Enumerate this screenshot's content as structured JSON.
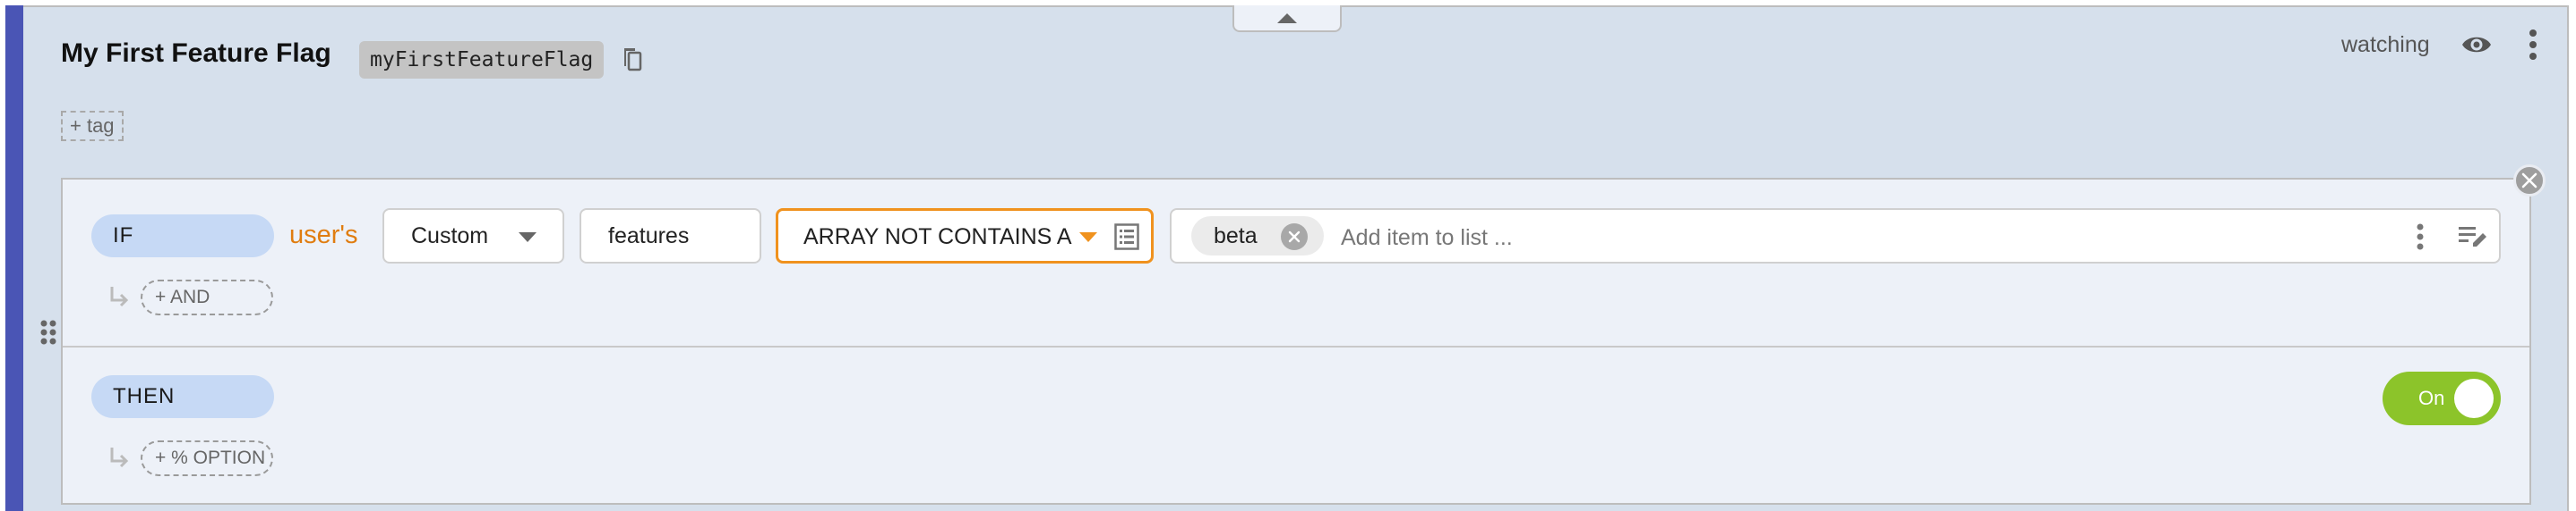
{
  "flag": {
    "title": "My First Feature Flag",
    "key": "myFirstFeatureFlag",
    "add_tag_label": "+ tag",
    "watch_status": "watching"
  },
  "rule": {
    "if_label": "IF",
    "subject_label": "user's",
    "attribute_type": "Custom",
    "attribute_name": "features",
    "operator": "ARRAY NOT CONTAINS A",
    "values": [
      "beta"
    ],
    "value_input_placeholder": "Add item to list ...",
    "add_and_label": "+ AND",
    "then_label": "THEN",
    "add_option_label": "+ % OPTION",
    "serve_toggle": {
      "label": "On",
      "state": "on"
    }
  },
  "colors": {
    "accent_bar": "#4a55b5",
    "panel_bg": "#d6e0ec",
    "card_bg": "#edf1f8",
    "pill_bg": "#c6d9f5",
    "subject_orange": "#e07d10",
    "operator_border": "#f0921e",
    "toggle_on": "#8cc42a"
  }
}
